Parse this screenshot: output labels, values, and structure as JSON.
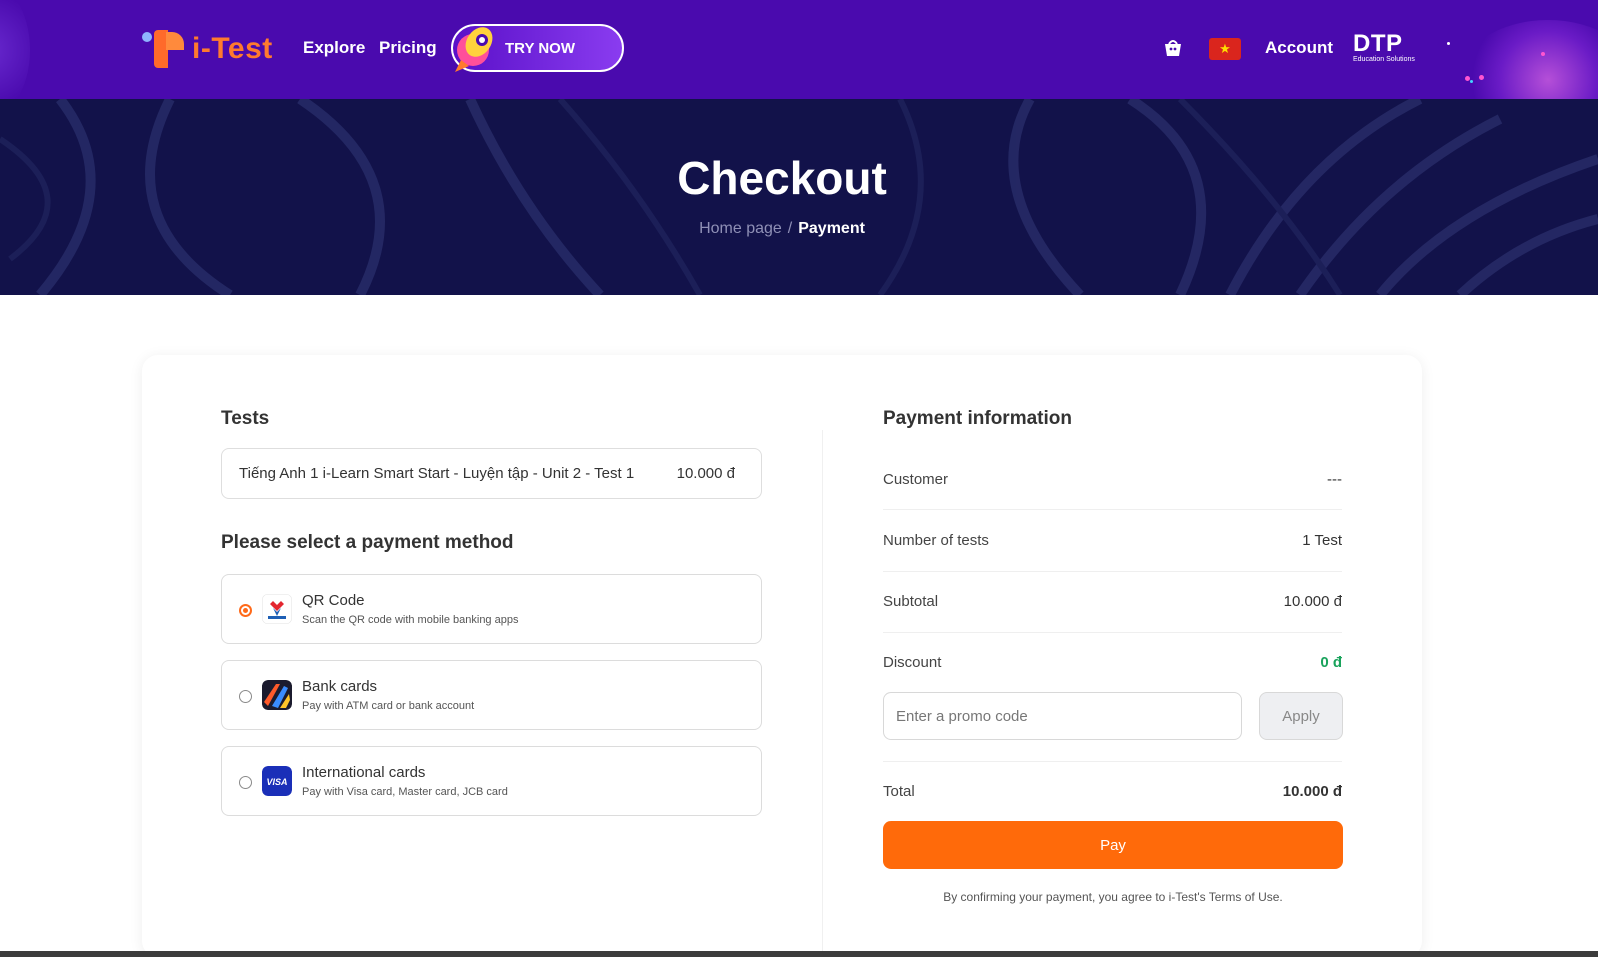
{
  "header": {
    "logo_text": "i-Test",
    "nav": {
      "explore": "Explore",
      "pricing": "Pricing"
    },
    "try_now": "TRY NOW",
    "account": "Account",
    "dtp_logo": "DTP",
    "dtp_tagline": "Education Solutions",
    "icons": {
      "cart": "basket-icon",
      "flag": "vietnam-flag-icon"
    },
    "colors": {
      "bar": "#4a0aae",
      "logo": "#ff7a2e"
    }
  },
  "hero": {
    "title": "Checkout",
    "breadcrumb": {
      "home": "Home page",
      "separator": "/",
      "current": "Payment"
    }
  },
  "tests": {
    "heading": "Tests",
    "items": [
      {
        "name": "Tiếng Anh 1 i-Learn Smart Start - Luyện tập - Unit 2 - Test 1",
        "price": "10.000 đ"
      }
    ]
  },
  "payment_methods": {
    "heading": "Please select a payment method",
    "options": [
      {
        "title": "QR Code",
        "desc": "Scan the QR code with mobile banking apps",
        "icon": "vnpay-icon",
        "selected": true
      },
      {
        "title": "Bank cards",
        "desc": "Pay with ATM card or bank account",
        "icon": "bank-cards-icon",
        "selected": false
      },
      {
        "title": "International cards",
        "desc": "Pay with Visa card, Master card, JCB card",
        "icon": "visa-icon",
        "selected": false
      }
    ]
  },
  "payment_info": {
    "heading": "Payment information",
    "customer_label": "Customer",
    "customer_value": "---",
    "num_tests_label": "Number of tests",
    "num_tests_value": "1 Test",
    "subtotal_label": "Subtotal",
    "subtotal_value": "10.000 đ",
    "discount_label": "Discount",
    "discount_value": "0 đ",
    "promo_placeholder": "Enter a promo code",
    "apply_label": "Apply",
    "total_label": "Total",
    "total_value": "10.000 đ",
    "pay_label": "Pay",
    "terms": "By confirming your payment, you agree to i-Test's Terms of Use.",
    "colors": {
      "pay": "#ff6a0a",
      "discount": "#1aa35c"
    }
  }
}
